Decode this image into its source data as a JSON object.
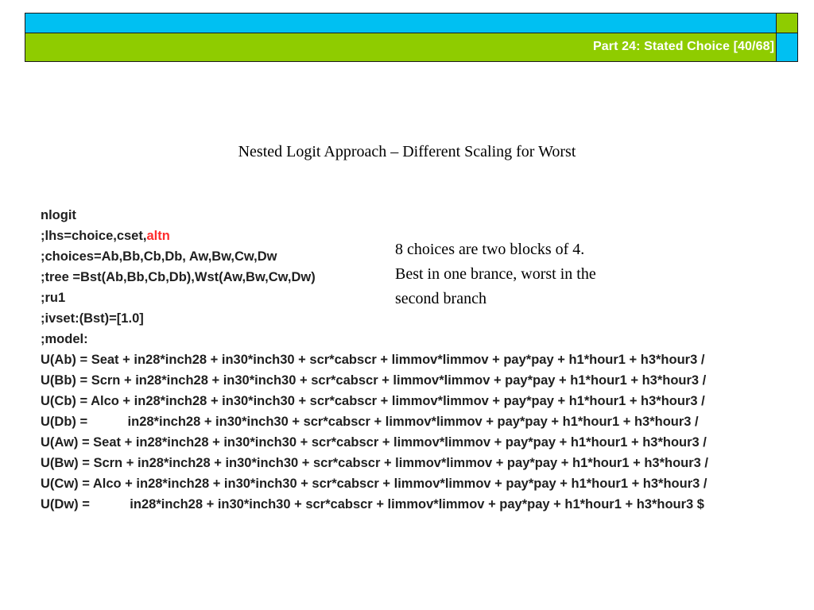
{
  "header": {
    "part_label": "Part 24: Stated Choice [40/68]",
    "colors": {
      "top_bar": "#00c0f2",
      "bottom_bar": "#8fcc00"
    }
  },
  "slide": {
    "title": "Nested Logit Approach – Different Scaling for Worst"
  },
  "code": {
    "line_0": "nlogit",
    "line_1_prefix": ";lhs=choice,cset,",
    "line_1_highlight": "altn",
    "line_2": ";choices=Ab,Bb,Cb,Db, Aw,Bw,Cw,Dw",
    "line_3": ";tree =Bst(Ab,Bb,Cb,Db),Wst(Aw,Bw,Cw,Dw)",
    "line_4": ";ru1",
    "line_5": ";ivset:(Bst)=[1.0]",
    "line_6": ";model:",
    "line_7": "U(Ab) = Seat + in28*inch28 + in30*inch30 + scr*cabscr + limmov*limmov + pay*pay + h1*hour1 + h3*hour3 /",
    "line_8": "U(Bb) = Scrn + in28*inch28 + in30*inch30 + scr*cabscr + limmov*limmov + pay*pay + h1*hour1 + h3*hour3 /",
    "line_9": "U(Cb) = Alco + in28*inch28 + in30*inch30 + scr*cabscr + limmov*limmov + pay*pay + h1*hour1 + h3*hour3 /",
    "line_10": "U(Db) =           in28*inch28 + in30*inch30 + scr*cabscr + limmov*limmov + pay*pay + h1*hour1 + h3*hour3 /",
    "line_11": "U(Aw) = Seat + in28*inch28 + in30*inch30 + scr*cabscr + limmov*limmov + pay*pay + h1*hour1 + h3*hour3 /",
    "line_12": "U(Bw) = Scrn + in28*inch28 + in30*inch30 + scr*cabscr + limmov*limmov + pay*pay + h1*hour1 + h3*hour3 /",
    "line_13": "U(Cw) = Alco + in28*inch28 + in30*inch30 + scr*cabscr + limmov*limmov + pay*pay + h1*hour1 + h3*hour3 /",
    "line_14": "U(Dw) =           in28*inch28 + in30*inch30 + scr*cabscr + limmov*limmov + pay*pay + h1*hour1 + h3*hour3 $",
    "highlight_color": "#ff2b2b"
  },
  "note": {
    "line_1": "8 choices are two blocks of 4.",
    "line_2": "Best in one brance, worst in the",
    "line_3": "second branch"
  }
}
